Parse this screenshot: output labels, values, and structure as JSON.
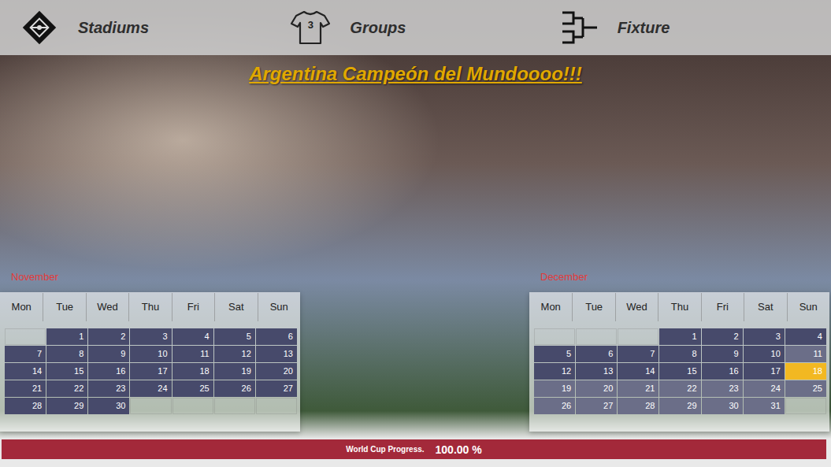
{
  "nav": [
    {
      "label": "Stadiums",
      "icon": "stadium"
    },
    {
      "label": "Groups",
      "icon": "shirt",
      "badge": "3"
    },
    {
      "label": "Fixture",
      "icon": "bracket"
    }
  ],
  "title": "Argentina Campeón del Mundoooo!!!",
  "calendars": [
    {
      "month": "November",
      "weekdays": [
        "Mon",
        "Tue",
        "Wed",
        "Thu",
        "Fri",
        "Sat",
        "Sun"
      ],
      "weeks": [
        [
          null,
          {
            "day": "1",
            "active": true,
            "selected": false
          },
          {
            "day": "2",
            "active": true,
            "selected": false
          },
          {
            "day": "3",
            "active": true,
            "selected": false
          },
          {
            "day": "4",
            "active": true,
            "selected": false
          },
          {
            "day": "5",
            "active": true,
            "selected": false
          },
          {
            "day": "6",
            "active": true,
            "selected": false
          }
        ],
        [
          {
            "day": "7",
            "active": true,
            "selected": false
          },
          {
            "day": "8",
            "active": true,
            "selected": false
          },
          {
            "day": "9",
            "active": true,
            "selected": false
          },
          {
            "day": "10",
            "active": true,
            "selected": false
          },
          {
            "day": "11",
            "active": true,
            "selected": false
          },
          {
            "day": "12",
            "active": true,
            "selected": false
          },
          {
            "day": "13",
            "active": true,
            "selected": false
          }
        ],
        [
          {
            "day": "14",
            "active": true,
            "selected": false
          },
          {
            "day": "15",
            "active": true,
            "selected": false
          },
          {
            "day": "16",
            "active": true,
            "selected": false
          },
          {
            "day": "17",
            "active": true,
            "selected": false
          },
          {
            "day": "18",
            "active": true,
            "selected": false
          },
          {
            "day": "19",
            "active": true,
            "selected": false
          },
          {
            "day": "20",
            "active": true,
            "selected": false
          }
        ],
        [
          {
            "day": "21",
            "active": true,
            "selected": false
          },
          {
            "day": "22",
            "active": true,
            "selected": false
          },
          {
            "day": "23",
            "active": true,
            "selected": false
          },
          {
            "day": "24",
            "active": true,
            "selected": false
          },
          {
            "day": "25",
            "active": true,
            "selected": false
          },
          {
            "day": "26",
            "active": true,
            "selected": false
          },
          {
            "day": "27",
            "active": true,
            "selected": false
          }
        ],
        [
          {
            "day": "28",
            "active": true,
            "selected": false
          },
          {
            "day": "29",
            "active": true,
            "selected": false
          },
          {
            "day": "30",
            "active": true,
            "selected": false
          },
          null,
          null,
          null,
          null
        ]
      ]
    },
    {
      "month": "December",
      "weekdays": [
        "Mon",
        "Tue",
        "Wed",
        "Thu",
        "Fri",
        "Sat",
        "Sun"
      ],
      "weeks": [
        [
          null,
          null,
          null,
          {
            "day": "1",
            "active": true,
            "selected": false
          },
          {
            "day": "2",
            "active": true,
            "selected": false
          },
          {
            "day": "3",
            "active": true,
            "selected": false
          },
          {
            "day": "4",
            "active": true,
            "selected": false
          }
        ],
        [
          {
            "day": "5",
            "active": true,
            "selected": false
          },
          {
            "day": "6",
            "active": true,
            "selected": false
          },
          {
            "day": "7",
            "active": true,
            "selected": false
          },
          {
            "day": "8",
            "active": true,
            "selected": false
          },
          {
            "day": "9",
            "active": true,
            "selected": false
          },
          {
            "day": "10",
            "active": true,
            "selected": false
          },
          {
            "day": "11",
            "active": false,
            "selected": false
          }
        ],
        [
          {
            "day": "12",
            "active": true,
            "selected": false
          },
          {
            "day": "13",
            "active": true,
            "selected": false
          },
          {
            "day": "14",
            "active": true,
            "selected": false
          },
          {
            "day": "15",
            "active": true,
            "selected": false
          },
          {
            "day": "16",
            "active": true,
            "selected": false
          },
          {
            "day": "17",
            "active": true,
            "selected": false
          },
          {
            "day": "18",
            "active": true,
            "selected": true
          }
        ],
        [
          {
            "day": "19",
            "active": false,
            "selected": false
          },
          {
            "day": "20",
            "active": false,
            "selected": false
          },
          {
            "day": "21",
            "active": false,
            "selected": false
          },
          {
            "day": "22",
            "active": false,
            "selected": false
          },
          {
            "day": "23",
            "active": false,
            "selected": false
          },
          {
            "day": "24",
            "active": false,
            "selected": false
          },
          {
            "day": "25",
            "active": false,
            "selected": false
          }
        ],
        [
          {
            "day": "26",
            "active": false,
            "selected": false
          },
          {
            "day": "27",
            "active": false,
            "selected": false
          },
          {
            "day": "28",
            "active": false,
            "selected": false
          },
          {
            "day": "29",
            "active": false,
            "selected": false
          },
          {
            "day": "30",
            "active": false,
            "selected": false
          },
          {
            "day": "31",
            "active": false,
            "selected": false
          },
          null
        ]
      ]
    }
  ],
  "progress": {
    "label": "World Cup Progress.",
    "reading": "100.00 %",
    "level": 1.0
  }
}
